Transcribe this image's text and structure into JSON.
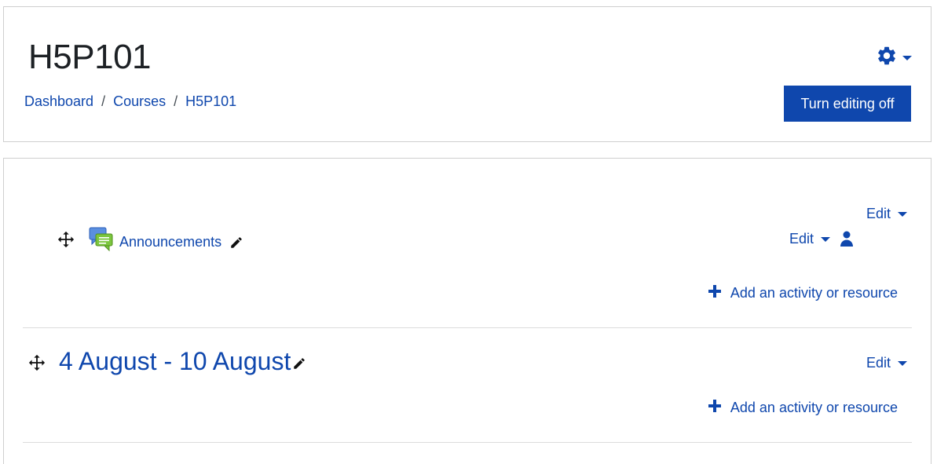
{
  "header": {
    "title": "H5P101",
    "breadcrumb": [
      {
        "label": "Dashboard"
      },
      {
        "label": "Courses"
      },
      {
        "label": "H5P101"
      }
    ],
    "breadcrumb_separator": "/",
    "turn_editing_label": "Turn editing off"
  },
  "section0": {
    "edit_label": "Edit",
    "activity": {
      "name": "Announcements",
      "icon": "forum-icon",
      "edit_label": "Edit"
    },
    "add_label": "Add an activity or resource"
  },
  "section1": {
    "title": "4 August - 10 August",
    "edit_label": "Edit",
    "add_label": "Add an activity or resource"
  },
  "colors": {
    "brand": "#0f47ad",
    "border": "#cfcfcf",
    "text": "#1d2125"
  }
}
